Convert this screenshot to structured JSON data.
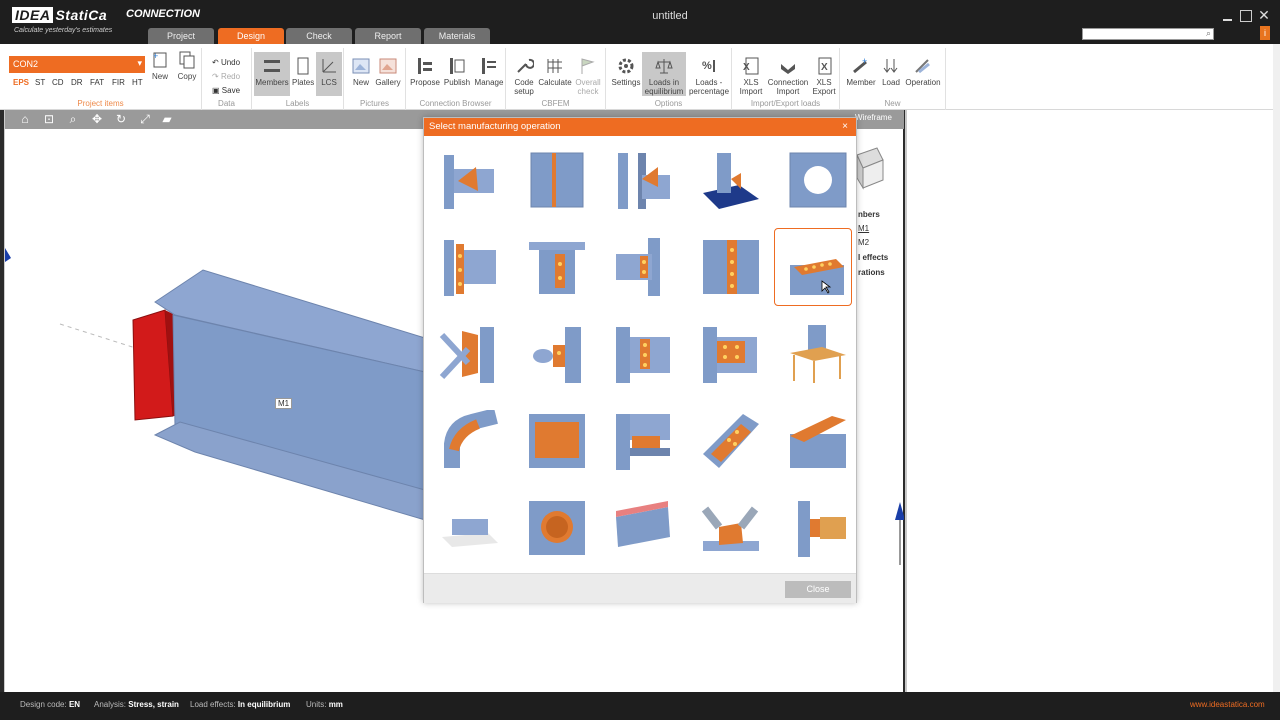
{
  "app": {
    "brand": "IDEA StatiCa",
    "product": "CONNECTION",
    "tagline": "Calculate yesterday's estimates",
    "document_title": "untitled"
  },
  "tabs": [
    {
      "label": "Project",
      "active": false
    },
    {
      "label": "Design",
      "active": true
    },
    {
      "label": "Check",
      "active": false
    },
    {
      "label": "Report",
      "active": false
    },
    {
      "label": "Materials",
      "active": false
    }
  ],
  "ribbon": {
    "project_items": {
      "selected": "CON2",
      "load_types": [
        "EPS",
        "ST",
        "CD",
        "DR",
        "FAT",
        "FIR",
        "HT"
      ],
      "new_label": "New",
      "copy_label": "Copy",
      "group_label": "Project items"
    },
    "data": {
      "undo": "Undo",
      "redo": "Redo",
      "save": "Save",
      "group_label": "Data"
    },
    "labels": {
      "members": "Members",
      "plates": "Plates",
      "lcs": "LCS",
      "group_label": "Labels"
    },
    "pictures": {
      "new": "New",
      "gallery": "Gallery",
      "group_label": "Pictures"
    },
    "connection_browser": {
      "propose": "Propose",
      "publish": "Publish",
      "manage": "Manage",
      "group_label": "Connection Browser"
    },
    "cbfem": {
      "code_setup_1": "Code",
      "code_setup_2": "setup",
      "calculate": "Calculate",
      "overall_check_1": "Overall",
      "overall_check_2": "check",
      "group_label": "CBFEM"
    },
    "options": {
      "settings": "Settings",
      "loads_equilibrium_1": "Loads in",
      "loads_equilibrium_2": "equilibrium",
      "loads_percentage_1": "Loads -",
      "loads_percentage_2": "percentage",
      "group_label": "Options"
    },
    "import_export": {
      "xls_import_1": "XLS",
      "xls_import_2": "Import",
      "connection_import_1": "Connection",
      "connection_import_2": "Import",
      "xls_export_1": "XLS",
      "xls_export_2": "Export",
      "group_label": "Import/Export loads"
    },
    "new_group": {
      "member": "Member",
      "load": "Load",
      "operation": "Operation",
      "group_label": "New"
    }
  },
  "viewport": {
    "wireframe_label": "Wireframe",
    "member_label": "M1",
    "tree": {
      "members_partial": "nbers",
      "m1": "M1",
      "m2": "M2",
      "effects_partial": "l effects",
      "operations_partial": "rations"
    }
  },
  "modal": {
    "title": "Select manufacturing operation",
    "close_x": "×",
    "close_button": "Close",
    "selected_index": 9
  },
  "status_bar": {
    "design_code_label": "Design code:",
    "design_code_value": "EN",
    "analysis_label": "Analysis:",
    "analysis_value": "Stress, strain",
    "load_effects_label": "Load effects:",
    "load_effects_value": "In equilibrium",
    "units_label": "Units:",
    "units_value": "mm",
    "website": "www.ideastatica.com"
  },
  "colors": {
    "accent": "#ee6c22",
    "steel": "#7f9bc8",
    "plate": "#e07a30",
    "red_plate": "#d21a1a"
  }
}
